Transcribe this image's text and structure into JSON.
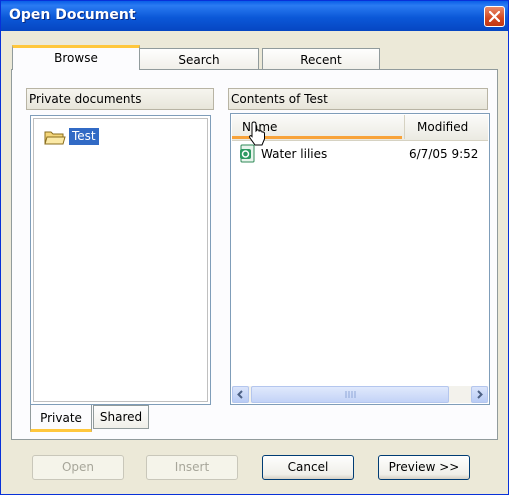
{
  "window": {
    "title": "Open Document",
    "close_icon": "close-x-icon"
  },
  "tabs": [
    {
      "label": "Browse",
      "active": true
    },
    {
      "label": "Search",
      "active": false
    },
    {
      "label": "Recent",
      "active": false
    }
  ],
  "left_pane": {
    "label": "Private documents",
    "tree": [
      {
        "label": "Test",
        "icon": "folder-open-icon",
        "selected": true
      }
    ],
    "subtabs": [
      {
        "label": "Private",
        "active": true
      },
      {
        "label": "Shared",
        "active": false
      }
    ]
  },
  "right_pane": {
    "label": "Contents of Test",
    "columns": {
      "name": "Name",
      "modified": "Modified"
    },
    "rows": [
      {
        "name": "Water lilies",
        "modified": "6/7/05 9:52",
        "icon": "image-document-icon"
      }
    ]
  },
  "buttons": {
    "open": "Open",
    "insert": "Insert",
    "cancel": "Cancel",
    "preview": "Preview >>"
  },
  "colors": {
    "titlebar": "#0a5fe8",
    "selection": "#316ac5",
    "tab_highlight": "#ffc73c",
    "sort_indicator": "#f8a33a"
  }
}
